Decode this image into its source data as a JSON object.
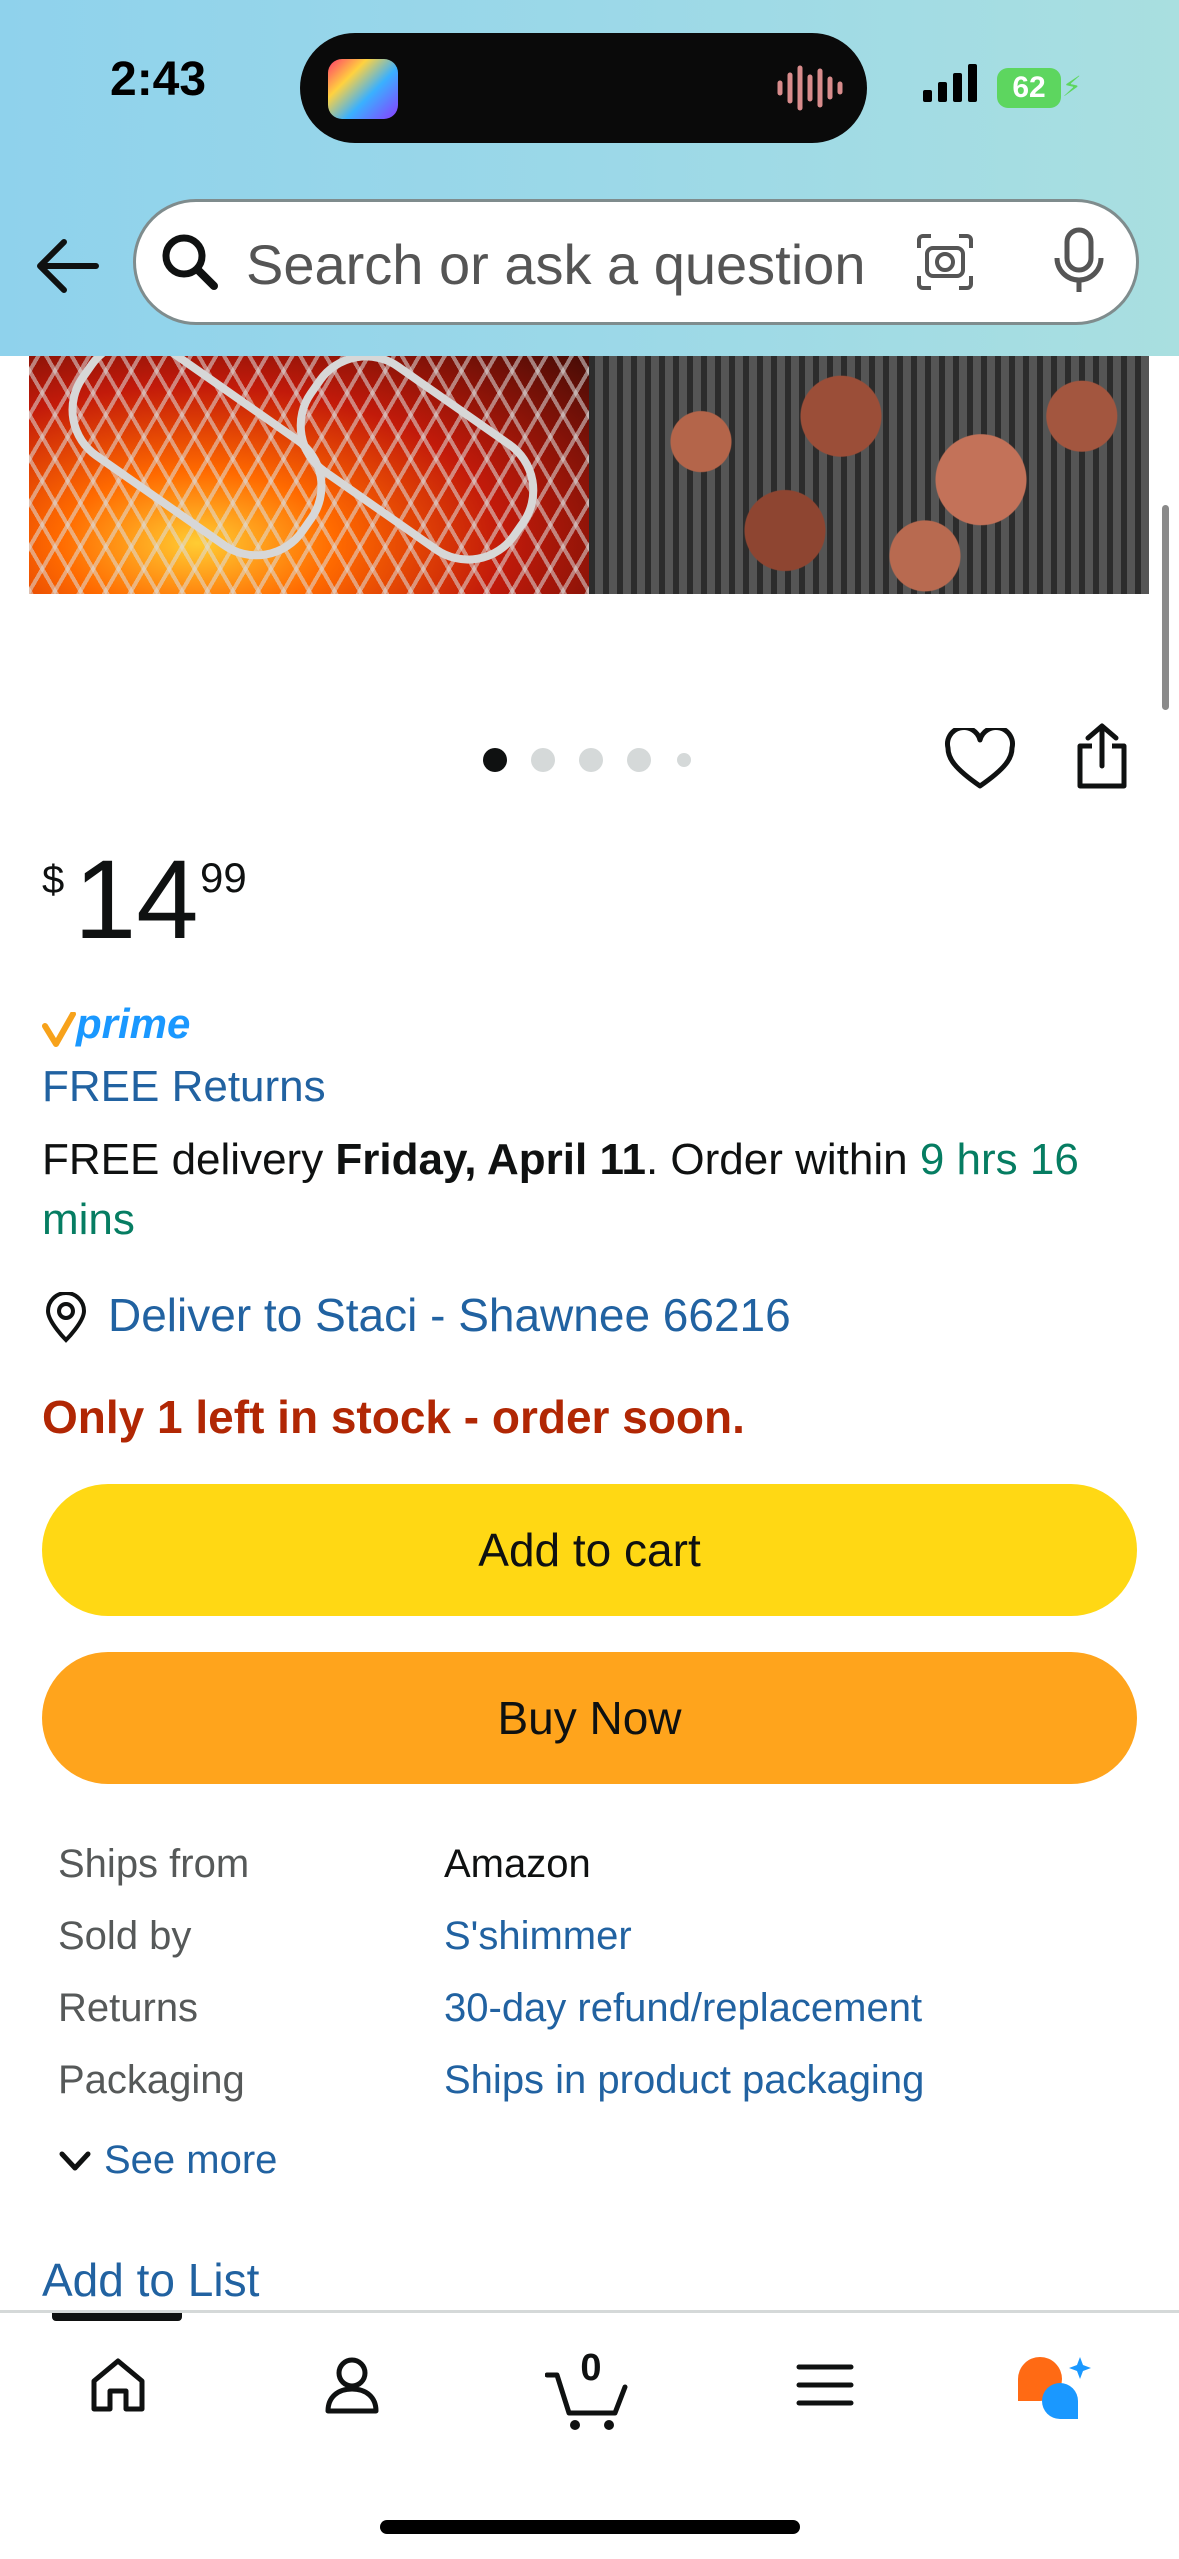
{
  "status_bar": {
    "time": "2:43",
    "battery": "62"
  },
  "search": {
    "placeholder": "Search or ask a question"
  },
  "product": {
    "price_currency": "$",
    "price_whole": "14",
    "price_fraction": "99",
    "prime_label": "prime",
    "free_returns": "FREE Returns",
    "delivery_prefix": "FREE delivery ",
    "delivery_date": "Friday, April 11",
    "delivery_mid": ". Order within ",
    "delivery_countdown": "9 hrs 16 mins",
    "deliver_to": "Deliver to Staci - Shawnee 66216",
    "stock_status": "Only 1 left in stock - order soon."
  },
  "carousel": {
    "active_index": 0,
    "count": 5
  },
  "buttons": {
    "add_to_cart": "Add to cart",
    "buy_now": "Buy Now"
  },
  "details": [
    {
      "label": "Ships from",
      "value": "Amazon"
    },
    {
      "label": "Sold by",
      "value": "S'shimmer"
    },
    {
      "label": "Returns",
      "value": "30-day refund/replacement"
    },
    {
      "label": "Packaging",
      "value": "Ships in product packaging"
    }
  ],
  "see_more": "See more",
  "add_to_list": "Add to List",
  "bottom_nav": {
    "cart_count": "0"
  },
  "colors": {
    "header_bg": "#9bd8e8",
    "link": "#2162a1",
    "stock_red": "#b12704",
    "green": "#067d62",
    "add_to_cart": "#ffd814",
    "buy_now": "#ffa41c",
    "prime_blue": "#1a98ff"
  }
}
